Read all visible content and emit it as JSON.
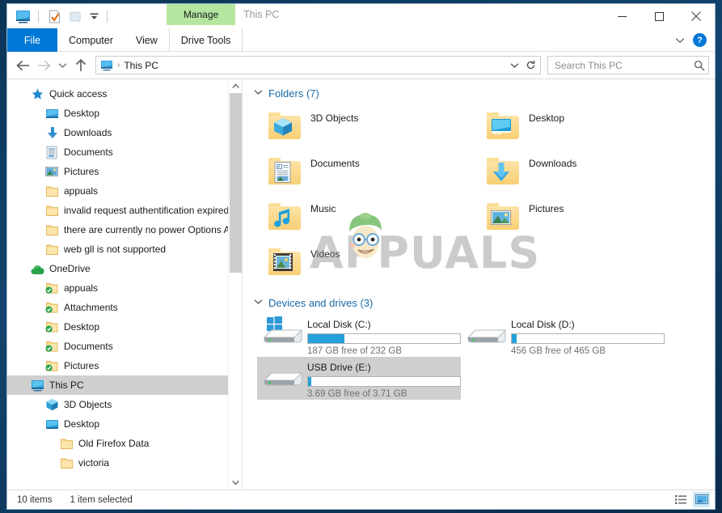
{
  "window": {
    "title": "This PC",
    "contextual_tab": "Manage",
    "minimize_icon": "minimize-icon",
    "maximize_icon": "maximize-icon",
    "close_icon": "close-icon"
  },
  "quick_access_toolbar": {
    "items": [
      {
        "name": "this-pc-icon",
        "tooltip": "This PC"
      },
      {
        "name": "properties-icon",
        "tooltip": "Properties"
      },
      {
        "name": "new-folder-icon",
        "tooltip": "New folder"
      },
      {
        "name": "customize-chevron-icon",
        "tooltip": "Customize Quick Access Toolbar"
      }
    ]
  },
  "ribbon": {
    "tabs": [
      {
        "label": "File",
        "name": "tab-file",
        "active": false
      },
      {
        "label": "Computer",
        "name": "tab-computer",
        "active": false
      },
      {
        "label": "View",
        "name": "tab-view",
        "active": false
      },
      {
        "label": "Drive Tools",
        "name": "tab-drive-tools",
        "active": true
      }
    ],
    "collapse_icon": "chevron-down-icon",
    "help_label": "?"
  },
  "addressbar": {
    "back_icon": "back-arrow-icon",
    "forward_icon": "forward-arrow-icon",
    "recent_icon": "chevron-down-icon",
    "up_icon": "up-arrow-icon",
    "path_icon": "this-pc-icon",
    "path_text": "This PC",
    "separator": "›",
    "dropdown_icon": "chevron-down-icon",
    "refresh_icon": "refresh-icon"
  },
  "search": {
    "placeholder": "Search This PC",
    "icon": "search-icon"
  },
  "navigation_pane": {
    "items": [
      {
        "label": "Quick access",
        "icon": "star-pin-icon",
        "level": 0,
        "pinned": false,
        "selected": false
      },
      {
        "label": "Desktop",
        "icon": "desktop-icon",
        "level": 1,
        "pinned": true,
        "selected": false
      },
      {
        "label": "Downloads",
        "icon": "downloads-icon",
        "level": 1,
        "pinned": true,
        "selected": false
      },
      {
        "label": "Documents",
        "icon": "documents-icon",
        "level": 1,
        "pinned": true,
        "selected": false
      },
      {
        "label": "Pictures",
        "icon": "pictures-icon",
        "level": 1,
        "pinned": true,
        "selected": false
      },
      {
        "label": "appuals",
        "icon": "folder-icon",
        "level": 1,
        "pinned": false,
        "selected": false
      },
      {
        "label": "invalid request authentification expired",
        "icon": "folder-icon",
        "level": 1,
        "pinned": false,
        "selected": false
      },
      {
        "label": "there are currently no power Options Availa",
        "icon": "folder-icon",
        "level": 1,
        "pinned": false,
        "selected": false
      },
      {
        "label": "web gll is not supported",
        "icon": "folder-icon",
        "level": 1,
        "pinned": false,
        "selected": false
      },
      {
        "label": "OneDrive",
        "icon": "onedrive-icon",
        "level": 0,
        "pinned": false,
        "selected": false
      },
      {
        "label": "appuals",
        "icon": "folder-synced-icon",
        "level": 1,
        "pinned": false,
        "selected": false
      },
      {
        "label": "Attachments",
        "icon": "folder-synced-icon",
        "level": 1,
        "pinned": false,
        "selected": false
      },
      {
        "label": "Desktop",
        "icon": "folder-synced-icon",
        "level": 1,
        "pinned": false,
        "selected": false
      },
      {
        "label": "Documents",
        "icon": "folder-synced-icon",
        "level": 1,
        "pinned": false,
        "selected": false
      },
      {
        "label": "Pictures",
        "icon": "folder-synced-icon",
        "level": 1,
        "pinned": false,
        "selected": false
      },
      {
        "label": "This PC",
        "icon": "this-pc-icon",
        "level": 0,
        "pinned": false,
        "selected": true
      },
      {
        "label": "3D Objects",
        "icon": "3d-objects-icon",
        "level": 1,
        "pinned": false,
        "selected": false
      },
      {
        "label": "Desktop",
        "icon": "desktop-icon",
        "level": 1,
        "pinned": false,
        "selected": false
      },
      {
        "label": "Old Firefox Data",
        "icon": "folder-icon",
        "level": 2,
        "pinned": false,
        "selected": false
      },
      {
        "label": "victoria",
        "icon": "folder-icon",
        "level": 2,
        "pinned": false,
        "selected": false
      }
    ],
    "scrollbar": {
      "up_icon": "scroll-up-icon",
      "down_icon": "scroll-down-icon"
    }
  },
  "content": {
    "folders_group": {
      "header": "Folders (7)",
      "chevron": "∨",
      "items": [
        {
          "label": "3D Objects",
          "icon": "folder-3d-objects-icon"
        },
        {
          "label": "Desktop",
          "icon": "folder-desktop-icon"
        },
        {
          "label": "Documents",
          "icon": "folder-documents-icon"
        },
        {
          "label": "Downloads",
          "icon": "folder-downloads-icon"
        },
        {
          "label": "Music",
          "icon": "folder-music-icon"
        },
        {
          "label": "Pictures",
          "icon": "folder-pictures-icon"
        },
        {
          "label": "Videos",
          "icon": "folder-videos-icon"
        }
      ]
    },
    "drives_group": {
      "header": "Devices and drives (3)",
      "chevron": "∨",
      "items": [
        {
          "label": "Local Disk (C:)",
          "icon": "windows-drive-icon",
          "free_text": "187 GB free of 232 GB",
          "free_gb": 187,
          "total_gb": 232,
          "used_percent": 24,
          "selected": false
        },
        {
          "label": "Local Disk (D:)",
          "icon": "drive-icon",
          "free_text": "456 GB free of 465 GB",
          "free_gb": 456,
          "total_gb": 465,
          "used_percent": 3,
          "selected": false
        },
        {
          "label": "USB Drive (E:)",
          "icon": "usb-drive-icon",
          "free_text": "3.69 GB free of 3.71 GB",
          "free_gb": 3.69,
          "total_gb": 3.71,
          "used_percent": 2,
          "selected": true
        }
      ]
    },
    "watermark": {
      "text": "APPUALS",
      "mascot": "appuals-mascot-icon"
    }
  },
  "statusbar": {
    "item_count": "10 items",
    "selection": "1 item selected",
    "details_view_icon": "details-view-icon",
    "large_icons_view_icon": "large-icons-view-icon"
  },
  "colors": {
    "accent": "#0078d7",
    "capacity_bar": "#26a0da",
    "contextual_tab": "#b5e6a0",
    "selection": "#cfcfcf",
    "group_header": "#1a6ba8"
  }
}
